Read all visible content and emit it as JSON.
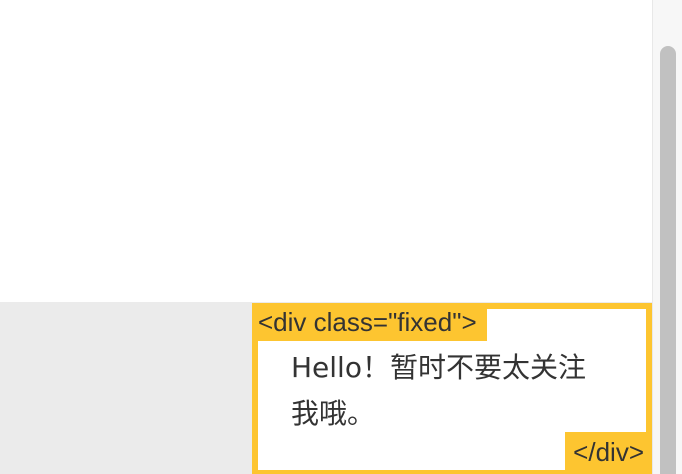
{
  "fixed_element": {
    "open_tag": "<div class=\"fixed\">",
    "content": "Hello！暂时不要太关注我哦。",
    "close_tag": "</div>"
  },
  "colors": {
    "accent": "#fdc530",
    "page_background": "#ffffff",
    "band_background": "#ebebeb",
    "text": "#333333",
    "scrollbar_thumb": "#c1c1c1"
  },
  "scrollbar": {
    "orientation": "vertical"
  }
}
